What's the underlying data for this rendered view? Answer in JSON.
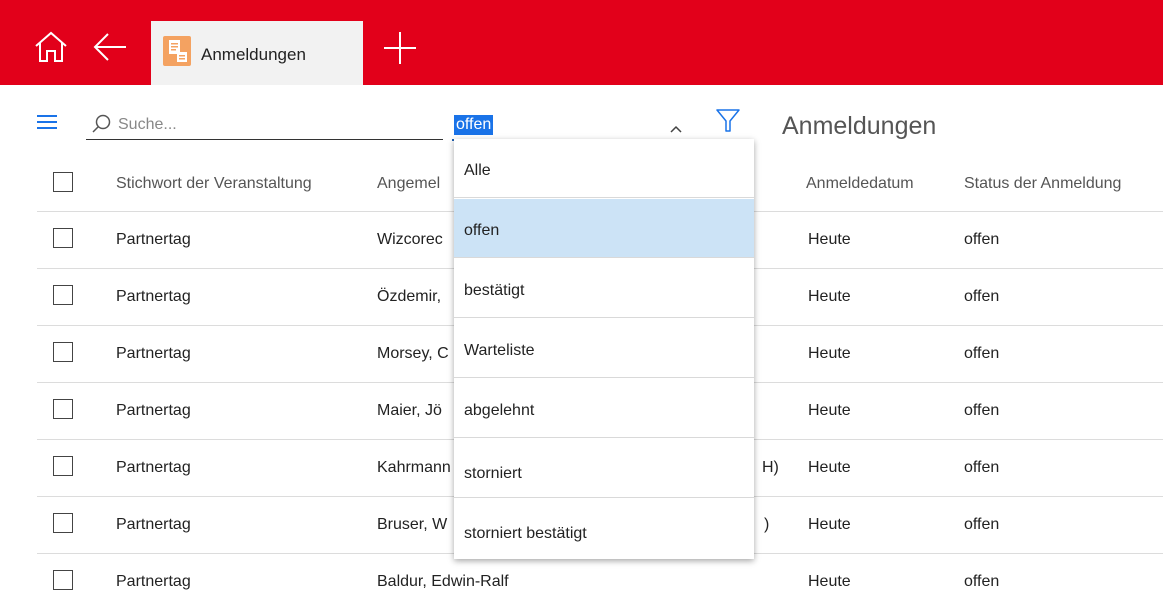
{
  "colors": {
    "brand_red": "#e2001a",
    "select_highlight": "#cce3f6",
    "accent_blue": "#1a73e8"
  },
  "topbar": {
    "home_icon": "home-icon",
    "back_icon": "arrow-left-icon",
    "tab": {
      "label": "Anmeldungen",
      "icon": "registration-app-icon"
    },
    "add_tab_icon": "plus-icon"
  },
  "toolbar": {
    "search": {
      "placeholder": "Suche..."
    },
    "status_filter": {
      "value": "offen"
    },
    "title": "Anmeldungen"
  },
  "table": {
    "columns": [
      "Stichwort der Veranstaltung",
      "Angemel",
      "Anmeldedatum",
      "Status der Anmeldung"
    ],
    "rows": [
      {
        "event": "Partnertag",
        "name": "Wizcorec",
        "date": "Heute",
        "status": "offen"
      },
      {
        "event": "Partnertag",
        "name": "Özdemir,",
        "date": "Heute",
        "status": "offen"
      },
      {
        "event": "Partnertag",
        "name": "Morsey, C",
        "date": "Heute",
        "status": "offen"
      },
      {
        "event": "Partnertag",
        "name": "Maier, Jö",
        "date": "Heute",
        "status": "offen"
      },
      {
        "event": "Partnertag",
        "name": "Kahrmann",
        "date": "Heute",
        "status": "offen"
      },
      {
        "event": "Partnertag",
        "name": "Bruser, W",
        "date": "Heute",
        "status": "offen"
      },
      {
        "event": "Partnertag",
        "name": "Baldur, Edwin-Ralf",
        "date": "Heute",
        "status": "offen"
      }
    ],
    "partial_tails": {
      "row5": "H)",
      "row6": ")"
    }
  },
  "dropdown": {
    "options": [
      "Alle",
      "offen",
      "bestätigt",
      "Warteliste",
      "abgelehnt",
      "storniert",
      "storniert bestätigt"
    ],
    "selected_index": 1
  }
}
